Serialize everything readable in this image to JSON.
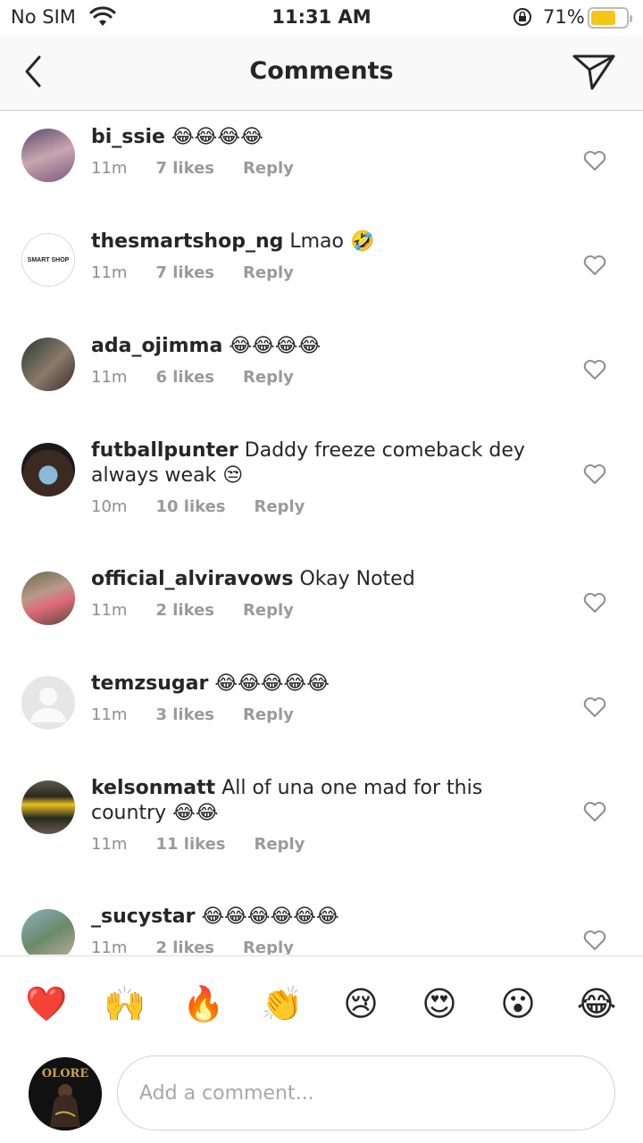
{
  "status_bar": {
    "carrier": "No SIM",
    "time": "11:31 AM",
    "battery_percent": "71%",
    "battery_level": 0.71,
    "battery_color": "#f5c518"
  },
  "nav": {
    "title": "Comments",
    "back_icon": "chevron-left-icon",
    "send_icon": "paper-plane-icon"
  },
  "comments": [
    {
      "username": "bi_ssie",
      "text": "😂😂😂😂",
      "time": "11m",
      "likes": "7 likes",
      "reply": "Reply"
    },
    {
      "username": "thesmartshop_ng",
      "text": "Lmao 🤣",
      "time": "11m",
      "likes": "7 likes",
      "reply": "Reply",
      "avatar_label": "SMART SHOP"
    },
    {
      "username": "ada_ojimma",
      "text": "😂😂😂😂",
      "time": "11m",
      "likes": "6 likes",
      "reply": "Reply"
    },
    {
      "username": "futballpunter",
      "text": "Daddy freeze comeback dey always weak 😒",
      "time": "10m",
      "likes": "10 likes",
      "reply": "Reply"
    },
    {
      "username": "official_alviravows",
      "text": "Okay Noted",
      "time": "11m",
      "likes": "2 likes",
      "reply": "Reply"
    },
    {
      "username": "temzsugar",
      "text": "😂😂😂😂😂",
      "time": "11m",
      "likes": "3 likes",
      "reply": "Reply"
    },
    {
      "username": "kelsonmatt",
      "text": "All of una one mad for this country 😂😂",
      "time": "11m",
      "likes": "11 likes",
      "reply": "Reply"
    },
    {
      "username": "_sucystar",
      "text": "😂😂😂😂😂😂",
      "time": "11m",
      "likes": "2 likes",
      "reply": "Reply"
    }
  ],
  "quick_reactions": [
    "❤️",
    "🙌",
    "🔥",
    "👏",
    "😢",
    "😍",
    "😮",
    "😂"
  ],
  "input": {
    "placeholder": "Add a comment...",
    "value": ""
  },
  "me_avatar_label": "OLORE"
}
